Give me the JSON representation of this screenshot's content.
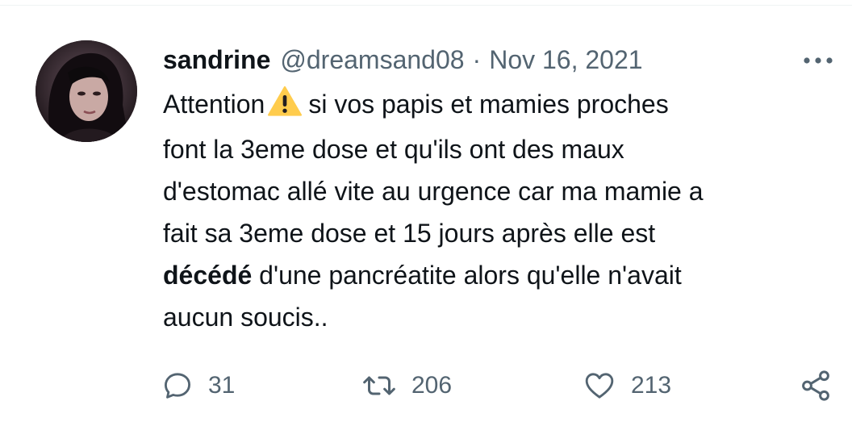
{
  "tweet": {
    "author": {
      "display_name": "sandrine",
      "handle": "@dreamsand08"
    },
    "separator": "·",
    "date": "Nov 16, 2021",
    "text": {
      "line1_before": "Attention",
      "line1_after": "si vos papis et mamies proches",
      "line2": "font la 3eme dose et qu'ils ont des maux",
      "line3": "d'estomac allé vite au urgence car ma mamie a",
      "line4": "fait sa 3eme dose et 15 jours après elle est",
      "line5_bold": "décédé",
      "line5_rest": " d'une pancréatite alors qu'elle n'avait",
      "line6": "aucun soucis.."
    },
    "icons": {
      "more": "more-horizontal-icon",
      "warning": "warning-icon",
      "reply": "reply-icon",
      "retweet": "retweet-icon",
      "like": "heart-icon",
      "share": "share-icon"
    },
    "stats": {
      "replies": "31",
      "retweets": "206",
      "likes": "213"
    },
    "colors": {
      "text": "#0f1419",
      "secondary": "#536471",
      "warning": "#ffcc4d"
    }
  }
}
